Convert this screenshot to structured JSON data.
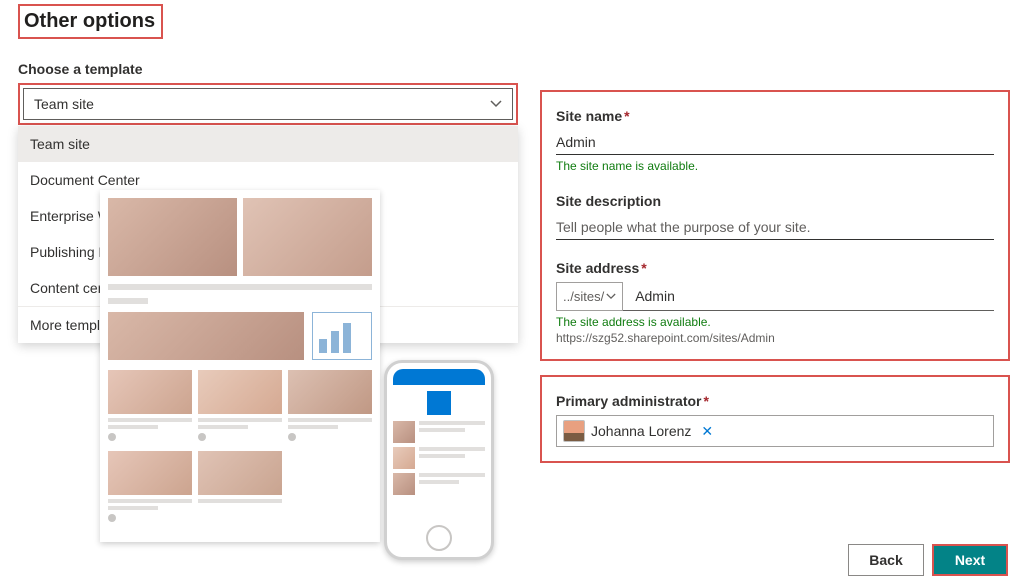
{
  "heading": "Other options",
  "template": {
    "label": "Choose a template",
    "selected": "Team site",
    "options": [
      "Team site",
      "Document Center",
      "Enterprise Wiki",
      "Publishing Portal",
      "Content center"
    ],
    "more_label": "More templates"
  },
  "form": {
    "site_name": {
      "label": "Site name",
      "value": "Admin",
      "helper": "The site name is available."
    },
    "site_description": {
      "label": "Site description",
      "placeholder": "Tell people what the purpose of your site."
    },
    "site_address": {
      "label": "Site address",
      "prefix": "../sites/",
      "value": "Admin",
      "helper": "The site address is available.",
      "full_url": "https://szg52.sharepoint.com/sites/Admin"
    },
    "admin": {
      "label": "Primary administrator",
      "name": "Johanna Lorenz"
    }
  },
  "buttons": {
    "back": "Back",
    "next": "Next"
  }
}
